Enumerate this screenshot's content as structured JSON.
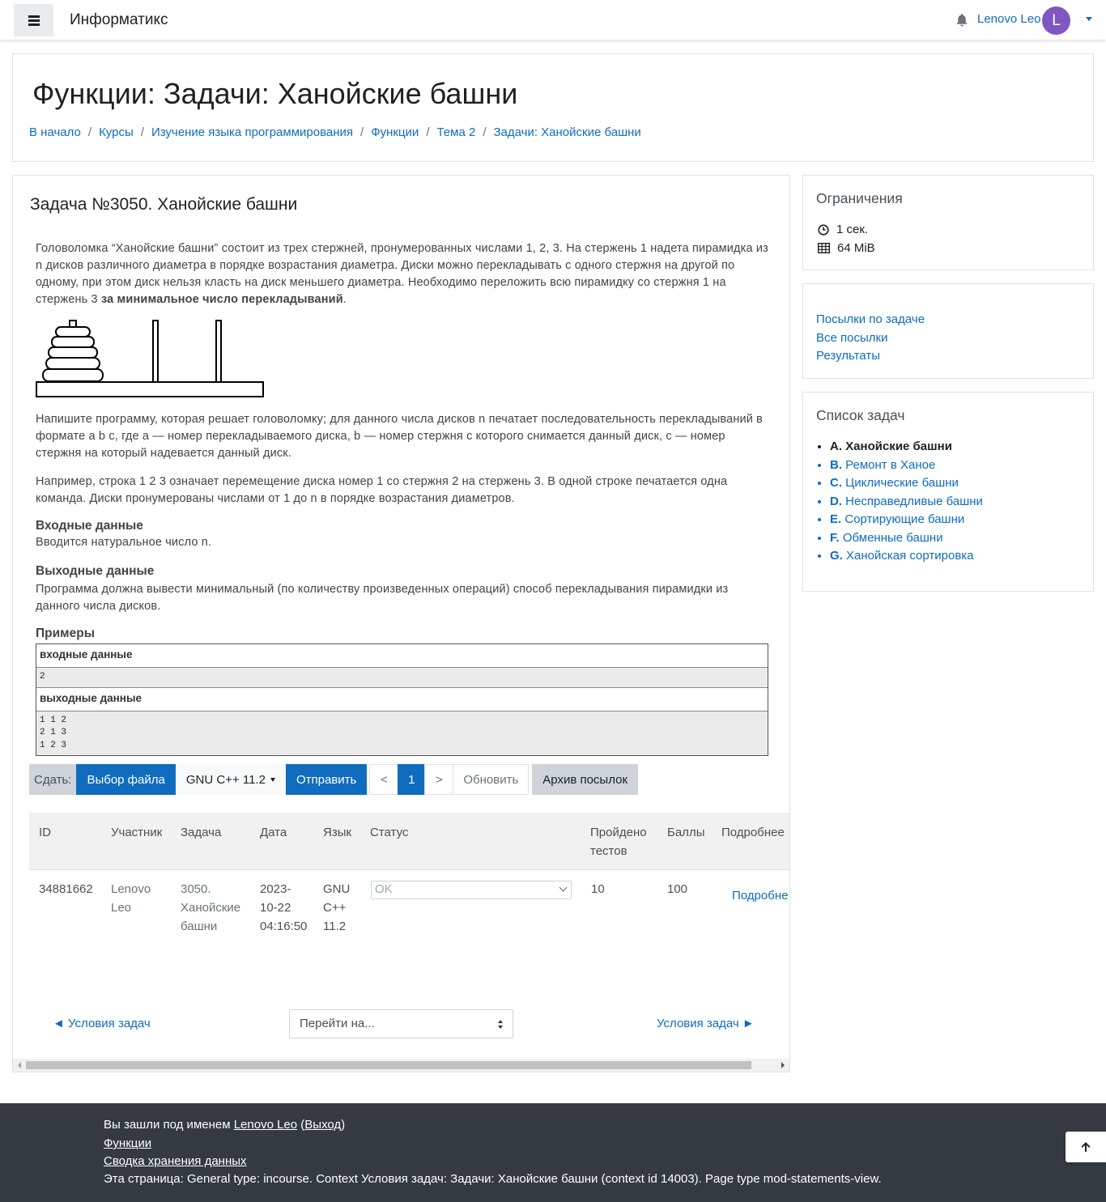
{
  "navbar": {
    "brand": "Информатикс",
    "username": "Lenovo Leo",
    "avatar_letter": "L",
    "icons": [
      "menu-icon",
      "bell-icon",
      "caret-down-icon"
    ]
  },
  "header": {
    "title": "Функции: Задачи: Ханойские башни",
    "breadcrumb": [
      "В начало",
      "Курсы",
      "Изучение языка программирования",
      "Функции",
      "Тема 2",
      "Задачи: Ханойские башни"
    ]
  },
  "task": {
    "title": "Задача №3050. Ханойские башни",
    "para1_text": "Головоломка “Ханойские башни” состоит из трех стержней, пронумерованных числами 1, 2, 3. На стержень 1 надета пирамидка из n дисков различного диаметра в порядке возрастания диаметра. Диски можно перекладывать с одного стержня на другой по одному, при этом диск нельзя класть на диск меньшего диаметра. Необходимо переложить всю пирамидку со стержня 1 на стержень 3 ",
    "para1_bold": "за минимальное число перекладываний",
    "para1_end": ".",
    "para2": "Напишите программу, которая решает головоломку; для данного числа дисков n печатает последовательность перекладываний в формате a b c, где a — номер перекладываемого диска, b — номер стержня с которого снимается данный диск, c — номер стержня на который надевается данный диск.",
    "para3": "Например, строка 1 2 3 означает перемещение диска номер 1 со стержня 2 на стержень 3. В одной строке печатается одна команда. Диски пронумерованы числами от 1 до n в порядке возрастания диаметров.",
    "input_heading": "Входные данные",
    "input_text": "Вводится натуральное число n.",
    "output_heading": "Выходные данные",
    "output_text": "Программа должна вывести минимальный (по количеству произведенных операций) способ перекладывания пирамидки из данного числа дисков.",
    "examples_heading": "Примеры",
    "examples": {
      "input_label": "входные данные",
      "input_value": "2",
      "output_label": "выходные данные",
      "output_value": "1 1 2\n2 1 3\n1 2 3"
    }
  },
  "submit_bar": {
    "label": "Сдать:",
    "file_button": "Выбор файла",
    "language": "GNU C++ 11.2",
    "send_button": "Отправить",
    "prev": "<",
    "page": "1",
    "next": ">",
    "refresh": "Обновить",
    "archive": "Архив посылок"
  },
  "submissions": {
    "headers": [
      "ID",
      "Участник",
      "Задача",
      "Дата",
      "Язык",
      "Статус",
      "Пройдено тестов",
      "Баллы",
      "Подробнее"
    ],
    "header_tests_line1": "Пройдено",
    "header_tests_line2": "тестов",
    "row": {
      "id": "34881662",
      "user_l1": "Lenovo",
      "user_l2": "Leo",
      "task_l1": "3050.",
      "task_l2": "Ханойские",
      "task_l3": "башни",
      "date_l1": "2023-",
      "date_l2": "10-22",
      "date_l3": "04:16:50",
      "lang_l1": "GNU",
      "lang_l2": "C++",
      "lang_l3": "11.2",
      "status": "OK",
      "tests": "10",
      "score": "100",
      "details": "Подробне"
    }
  },
  "bottom_nav": {
    "prev": "◄ Условия задач",
    "jump_placeholder": "Перейти на...",
    "next": "Условия задач ►"
  },
  "limits": {
    "title": "Ограничения",
    "time": "1 сек.",
    "memory": "64 MiB"
  },
  "links": {
    "items": [
      "Посылки по задаче",
      "Все посылки",
      "Результаты"
    ]
  },
  "task_list": {
    "title": "Список задач",
    "items": [
      {
        "letter": "A.",
        "name": "Ханойские башни",
        "active": true
      },
      {
        "letter": "B.",
        "name": "Ремонт в Ханое",
        "active": false
      },
      {
        "letter": "C.",
        "name": "Циклические башни",
        "active": false
      },
      {
        "letter": "D.",
        "name": "Несправедливые башни",
        "active": false
      },
      {
        "letter": "E.",
        "name": "Сортирующие башни",
        "active": false
      },
      {
        "letter": "F.",
        "name": "Обменные башни",
        "active": false
      },
      {
        "letter": "G.",
        "name": "Ханойская сортировка",
        "active": false
      }
    ]
  },
  "footer": {
    "logged_in_prefix": "Вы зашли под именем ",
    "user_link": "Lenovo Leo",
    "logout_open": " (",
    "logout_link": "Выход",
    "logout_close": ")",
    "link_functions": "Функции",
    "link_data": "Сводка хранения данных",
    "page_info": "Эта страница: General type: incourse. Context Условия задач: Задачи: Ханойские башни (context id 14003). Page type mod-statements-view."
  },
  "colors": {
    "accent": "#0f6cbf",
    "avatar": "#7e57c2",
    "footer_bg": "#343a40"
  }
}
